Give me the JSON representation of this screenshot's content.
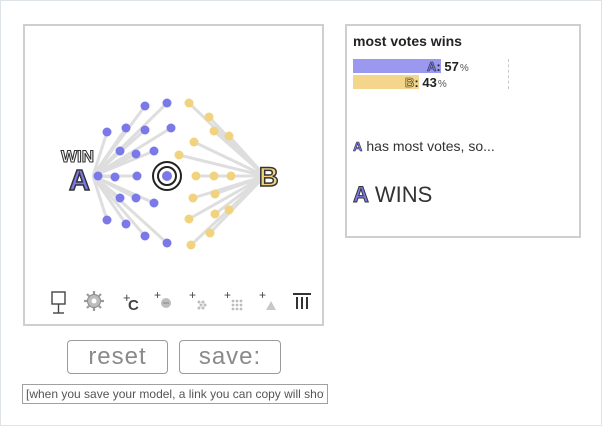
{
  "colors": {
    "candidate_a": "#7b78e8",
    "candidate_b": "#f1d27e",
    "candidate_a_bar": "#9b98f0",
    "candidate_b_bar": "#f3d68c",
    "line": "#dedede",
    "text": "#333333"
  },
  "simulation": {
    "win_label": "WIN",
    "candidate_a": {
      "letter": "A"
    },
    "candidate_b": {
      "letter": "B"
    },
    "voters_a_count": 19,
    "voters_b_count": 16,
    "toolbar": [
      {
        "name": "ballot-icon"
      },
      {
        "name": "gear-icon"
      },
      {
        "name": "add-candidate-icon",
        "plus": "+",
        "glyph": "C"
      },
      {
        "name": "add-voter-icon",
        "plus": "+"
      },
      {
        "name": "add-voter-crowd-icon",
        "plus": "+"
      },
      {
        "name": "add-voter-grid-icon",
        "plus": "+"
      },
      {
        "name": "add-triangle-icon",
        "plus": "+"
      },
      {
        "name": "pillars-icon"
      }
    ]
  },
  "result": {
    "title": "most votes wins",
    "bars": [
      {
        "letter": "A",
        "value": "57",
        "fraction": 0.57,
        "suffix": "%"
      },
      {
        "letter": "B",
        "value": "43",
        "fraction": 0.43,
        "suffix": "%"
      }
    ],
    "reason_letter": "A",
    "reason_text": "has most votes, so...",
    "winner_letter": "A",
    "winner_text": "WINS"
  },
  "controls": {
    "reset_label": "reset",
    "save_label": "save:",
    "link_value": "[when you save your model, a link you can copy will show up here]"
  }
}
